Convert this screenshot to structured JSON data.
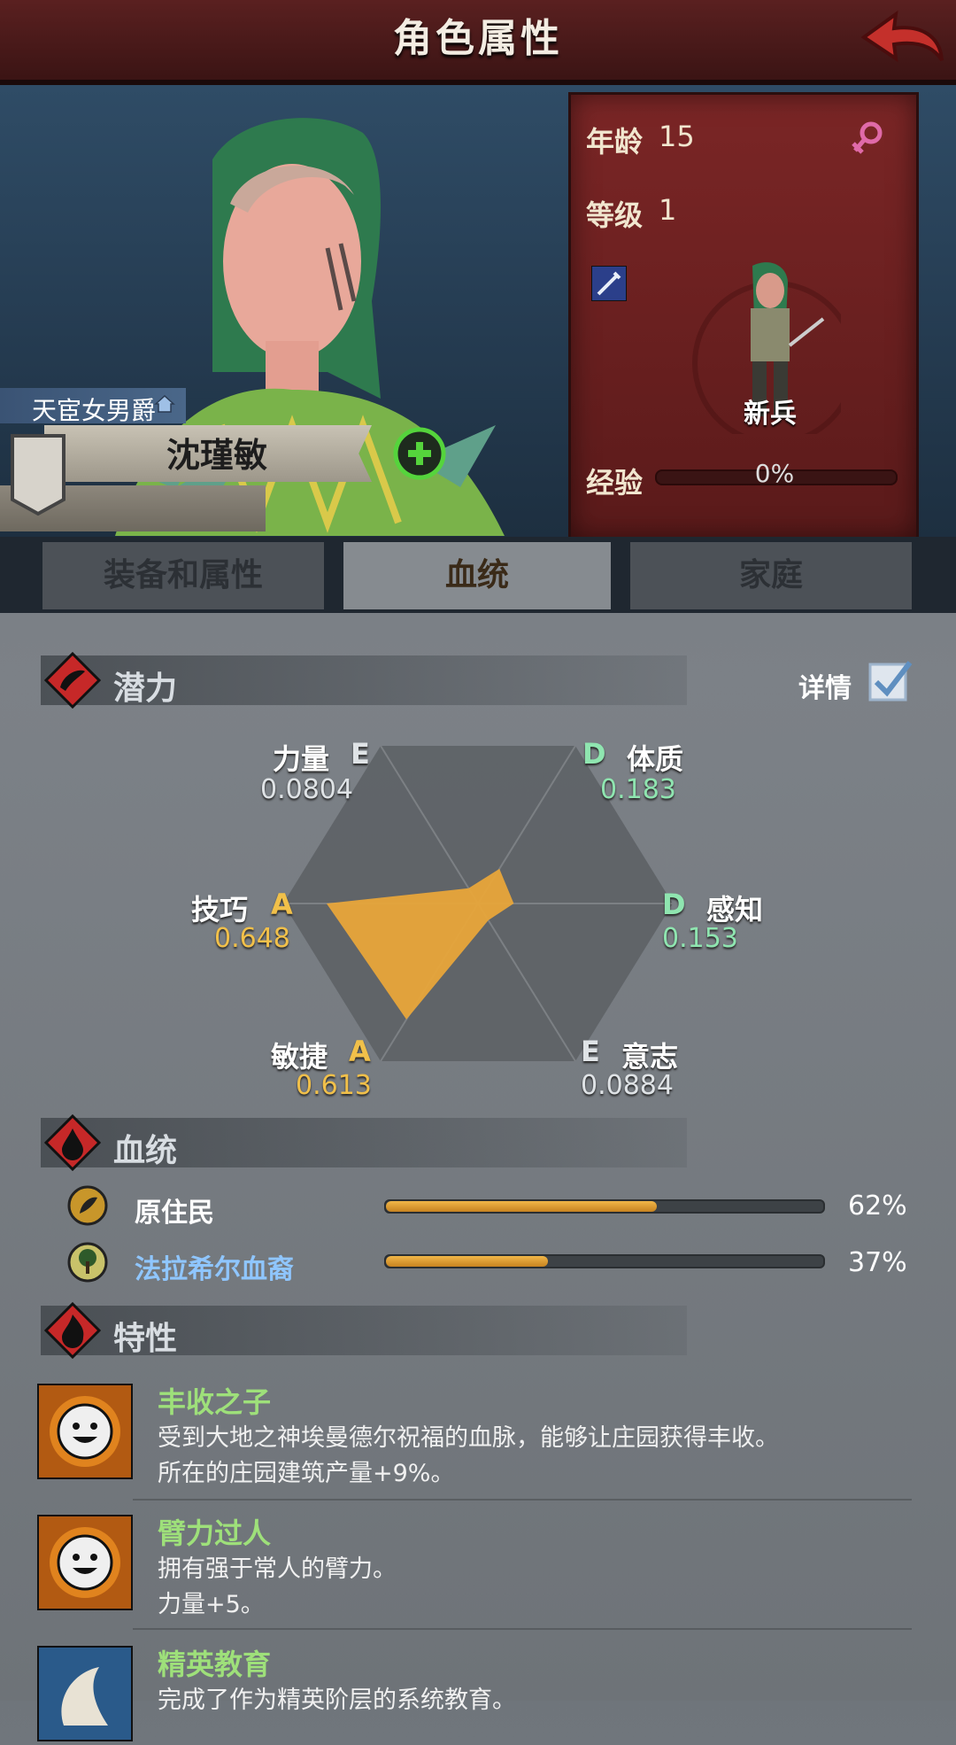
{
  "header": {
    "title": "角色属性"
  },
  "character": {
    "title": "天宦女男爵",
    "name": "沈瑾敏"
  },
  "card": {
    "age_label": "年龄",
    "age": "15",
    "level_label": "等级",
    "level": "1",
    "class_name": "新兵",
    "exp_label": "经验",
    "exp_value": "0%",
    "exp_fraction": 0
  },
  "tabs": [
    {
      "label": "装备和属性",
      "active": false
    },
    {
      "label": "血统",
      "active": true
    },
    {
      "label": "家庭",
      "active": false
    }
  ],
  "potential": {
    "title": "潜力",
    "detail_label": "详情",
    "detail_checked": true,
    "stats": [
      {
        "name": "力量",
        "grade": "E",
        "value": "0.0804"
      },
      {
        "name": "体质",
        "grade": "D",
        "value": "0.183"
      },
      {
        "name": "感知",
        "grade": "D",
        "value": "0.153"
      },
      {
        "name": "意志",
        "grade": "E",
        "value": "0.0884"
      },
      {
        "name": "敏捷",
        "grade": "A",
        "value": "0.613"
      },
      {
        "name": "技巧",
        "grade": "A",
        "value": "0.648"
      }
    ]
  },
  "bloodline": {
    "title": "血统",
    "rows": [
      {
        "name": "原住民",
        "percent": "62%",
        "fraction": 0.62
      },
      {
        "name": "法拉希尔血裔",
        "percent": "37%",
        "fraction": 0.37
      }
    ]
  },
  "traits": {
    "title": "特性",
    "items": [
      {
        "name": "丰收之子",
        "desc1": "受到大地之神埃曼德尔祝福的血脉，能够让庄园获得丰收。",
        "desc2": "所在的庄园建筑产量+9%。"
      },
      {
        "name": "臂力过人",
        "desc1": "拥有强于常人的臂力。",
        "desc2": "力量+5。"
      },
      {
        "name": "精英教育",
        "desc1": "完成了作为精英阶层的系统教育。",
        "desc2": ""
      }
    ]
  },
  "colors": {
    "accent": "#f0b648",
    "grade_A": "#f1c04a",
    "grade_D": "#8fe5b0",
    "grade_E": "#dfe3e6",
    "trait_name": "#9ee07a"
  }
}
